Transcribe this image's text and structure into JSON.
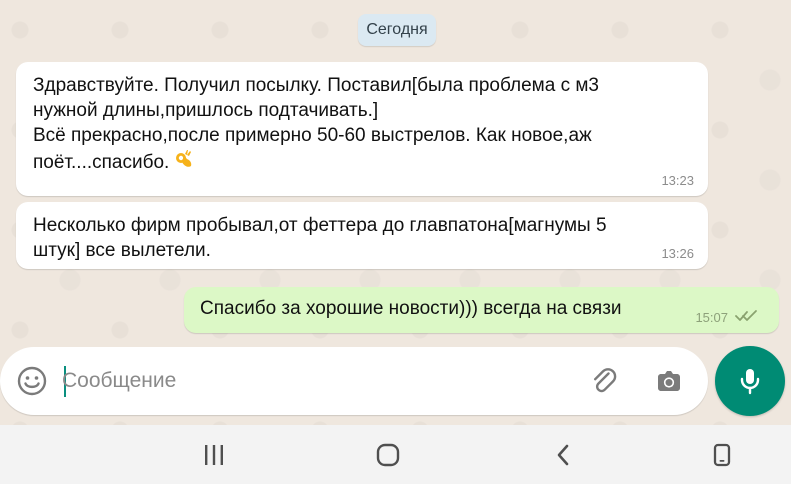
{
  "chat": {
    "date_label": "Сегодня",
    "messages": [
      {
        "direction": "incoming",
        "text": "Здравствуйте. Получил посылку. Поставил[была проблема с м3\nнужной длины,пришлось подтачивать.]\nВсё прекрасно,после примерно 50-60 выстрелов. Как новое,аж\nпоёт....спасибо.",
        "emoji": "ok-hand-emoji",
        "time": "13:23"
      },
      {
        "direction": "incoming",
        "text": "Несколько фирм пробывал,от феттера до главпатона[магнумы 5\nштук] все вылетели.",
        "time": "13:26"
      },
      {
        "direction": "outgoing",
        "text": "Спасибо за хорошие новости))) всегда на связи",
        "time": "15:07",
        "status_icon": "double-check-icon"
      }
    ]
  },
  "composer": {
    "placeholder": "Сообщение",
    "left_icon": "emoji-icon",
    "attach_icon": "paperclip-icon",
    "camera_icon": "camera-icon",
    "send_icon": "microphone-icon"
  },
  "navigation": {
    "icons": [
      "recent-apps-icon",
      "home-icon",
      "back-icon",
      "device-icon"
    ]
  },
  "colors": {
    "incoming_bubble": "#ffffff",
    "outgoing_bubble": "#dcf8c6",
    "accent": "#008b74",
    "date_chip": "#dbe9f2"
  }
}
